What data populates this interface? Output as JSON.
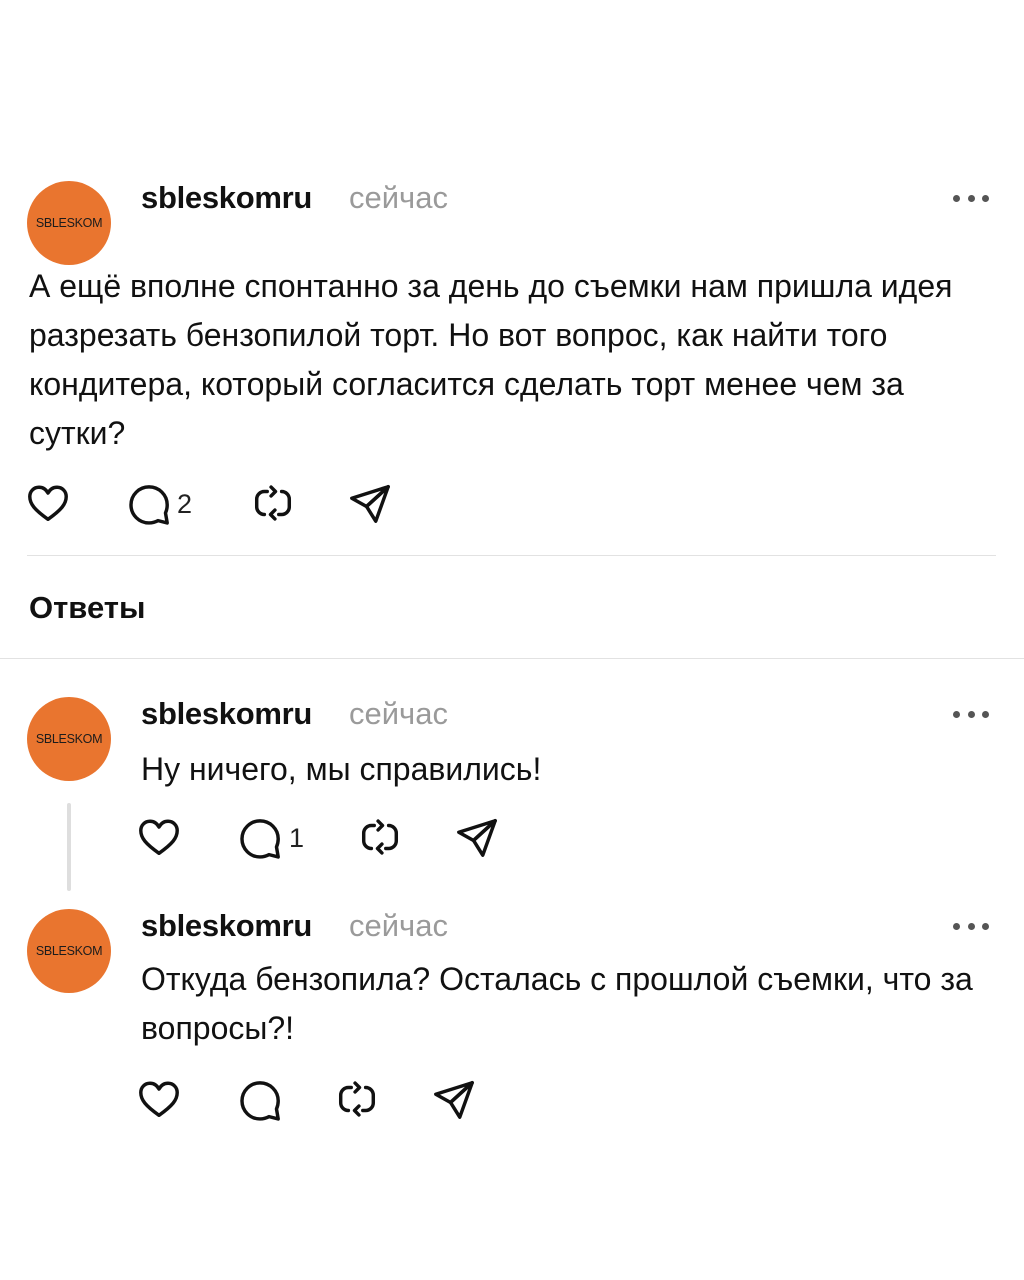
{
  "main_post": {
    "avatar_text": "SBLESKOM",
    "username": "sbleskomru",
    "time": "сейчас",
    "text": "А ещё вполне спонтанно за день до съемки нам пришла идея разрезать бензопилой торт. Но вот вопрос, как найти того кондитера, который согласится сделать торт менее чем за сутки?",
    "reply_count": "2"
  },
  "replies_header": "Ответы",
  "replies": [
    {
      "avatar_text": "SBLESKOM",
      "username": "sbleskomru",
      "time": "сейчас",
      "text": "Ну ничего, мы справились!",
      "reply_count": "1"
    },
    {
      "avatar_text": "SBLESKOM",
      "username": "sbleskomru",
      "time": "сейчас",
      "text": "Откуда бензопила? Осталась с прошлой съемки, что за вопросы?!",
      "reply_count": ""
    }
  ],
  "icons": [
    "heart-icon",
    "comment-icon",
    "repost-icon",
    "share-icon",
    "more-icon"
  ],
  "colors": {
    "avatar": "#e9752f",
    "time": "#9a9a9a",
    "divider": "#e2e2e2",
    "thread_line": "#dedede"
  }
}
